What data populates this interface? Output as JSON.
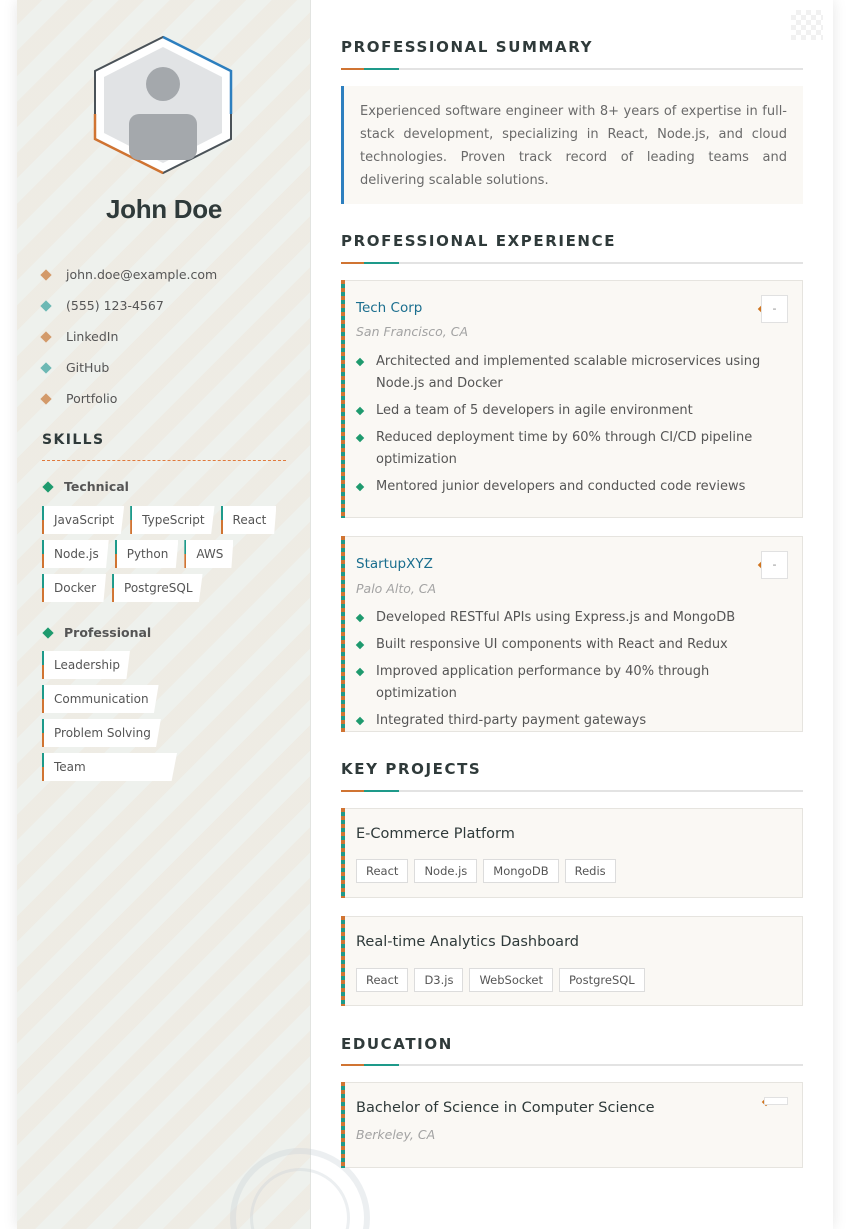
{
  "profile": {
    "name": "John Doe",
    "contact": [
      {
        "icon": "diamond-icon",
        "color": "#d39a6a",
        "text": "john.doe@example.com"
      },
      {
        "icon": "diamond-icon",
        "color": "#6cb8b4",
        "text": "(555) 123-4567"
      },
      {
        "icon": "diamond-icon",
        "color": "#d39a6a",
        "text": "LinkedIn"
      },
      {
        "icon": "diamond-icon",
        "color": "#6cb8b4",
        "text": "GitHub"
      },
      {
        "icon": "diamond-icon",
        "color": "#d39a6a",
        "text": "Portfolio"
      }
    ]
  },
  "skills": {
    "title": "SKILLS",
    "groups": [
      {
        "title": "Technical",
        "items": [
          "JavaScript",
          "TypeScript",
          "React",
          "Node.js",
          "Python",
          "AWS",
          "Docker",
          "PostgreSQL"
        ]
      },
      {
        "title": "Professional",
        "items": [
          "Leadership",
          "Communication",
          "Problem Solving",
          "Team Collaboration"
        ]
      }
    ]
  },
  "summary": {
    "title": "PROFESSIONAL SUMMARY",
    "text": "Experienced software engineer with 8+ years of expertise in full-stack development, specializing in React, Node.js, and cloud technologies. Proven track record of leading teams and delivering scalable solutions."
  },
  "experience": {
    "title": "PROFESSIONAL EXPERIENCE",
    "items": [
      {
        "company": "Tech Corp",
        "location": "San Francisco, CA",
        "dates": "-",
        "bullets": [
          "Architected and implemented scalable microservices using Node.js and Docker",
          "Led a team of 5 developers in agile environment",
          "Reduced deployment time by 60% through CI/CD pipeline optimization",
          "Mentored junior developers and conducted code reviews"
        ]
      },
      {
        "company": "StartupXYZ",
        "location": "Palo Alto, CA",
        "dates": "-",
        "bullets": [
          "Developed RESTful APIs using Express.js and MongoDB",
          "Built responsive UI components with React and Redux",
          "Improved application performance by 40% through optimization",
          "Integrated third-party payment gateways"
        ]
      }
    ]
  },
  "projects": {
    "title": "KEY PROJECTS",
    "items": [
      {
        "name": "E-Commerce Platform",
        "tags": [
          "React",
          "Node.js",
          "MongoDB",
          "Redis"
        ]
      },
      {
        "name": "Real-time Analytics Dashboard",
        "tags": [
          "React",
          "D3.js",
          "WebSocket",
          "PostgreSQL"
        ]
      }
    ]
  },
  "education": {
    "title": "EDUCATION",
    "items": [
      {
        "degree": "Bachelor of Science in Computer Science",
        "location": "Berkeley, CA",
        "dates": ""
      }
    ]
  },
  "colors": {
    "accent_teal": "#1e9a8a",
    "accent_orange": "#d07432",
    "link_blue": "#1a6e8e",
    "summary_border": "#2d7fbf"
  }
}
